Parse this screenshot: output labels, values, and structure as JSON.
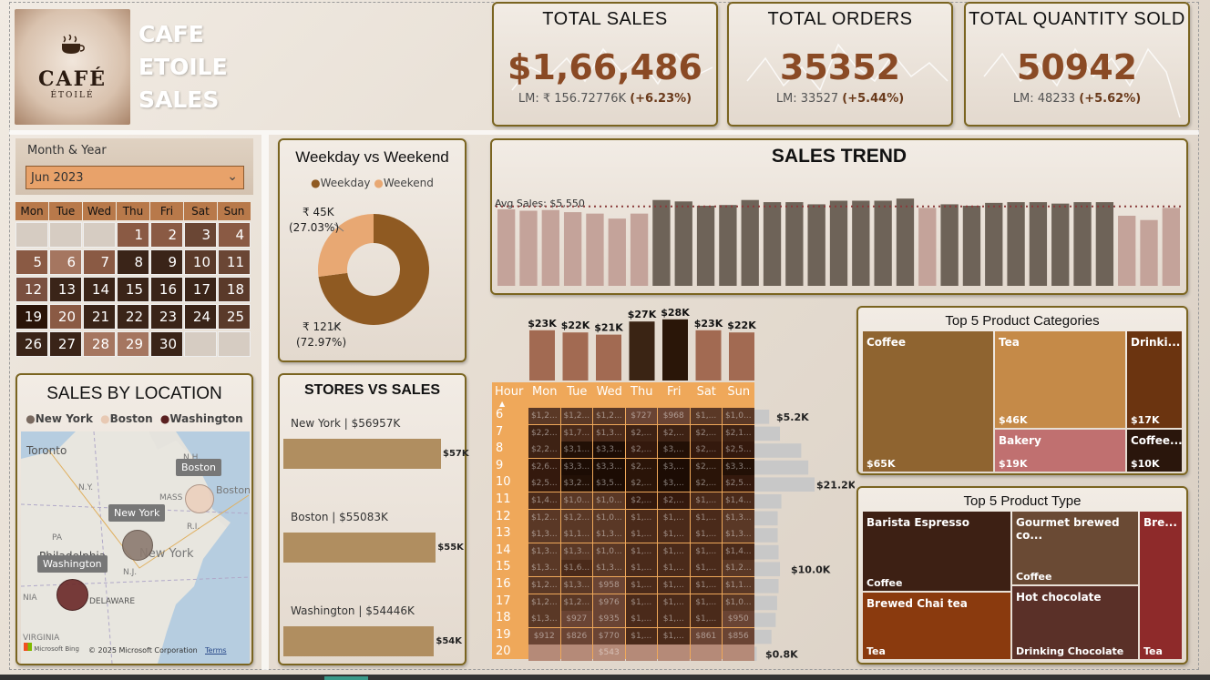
{
  "header": {
    "title_line1": "CAFE",
    "title_line2": "ETOILE",
    "title_line3": "SALES",
    "logo_top": "CAFE",
    "logo_main": "CAFÉ",
    "logo_sub": "ÉTOILÉ"
  },
  "kpis": [
    {
      "title": "TOTAL SALES",
      "value": "$1,66,486",
      "sub_prefix": "LM: ₹ 156.72776K ",
      "sub_change": "(+6.23%)"
    },
    {
      "title": "TOTAL ORDERS",
      "value": "35352",
      "sub_prefix": "LM: 33527 ",
      "sub_change": "(+5.44%)"
    },
    {
      "title": "TOTAL QUANTITY SOLD",
      "value": "50942",
      "sub_prefix": "LM: 48233 ",
      "sub_change": "(+5.62%)"
    }
  ],
  "slicer": {
    "label": "Month & Year",
    "value": "Jun 2023"
  },
  "calendar": {
    "days": [
      "Mon",
      "Tue",
      "Wed",
      "Thu",
      "Fri",
      "Sat",
      "Sun"
    ],
    "weeks": [
      [
        "",
        "",
        "",
        "1",
        "2",
        "3",
        "4"
      ],
      [
        "5",
        "6",
        "7",
        "8",
        "9",
        "10",
        "11"
      ],
      [
        "12",
        "13",
        "14",
        "15",
        "16",
        "17",
        "18"
      ],
      [
        "19",
        "20",
        "21",
        "22",
        "23",
        "24",
        "25"
      ],
      [
        "26",
        "27",
        "28",
        "29",
        "30",
        "",
        ""
      ]
    ]
  },
  "weekday_weekend": {
    "title": "Weekday vs Weekend",
    "legend": [
      "Weekday",
      "Weekend"
    ],
    "colors": [
      "#8f5a22",
      "#e8a873"
    ],
    "chart_data": {
      "type": "pie",
      "labels": [
        "Weekday",
        "Weekend"
      ],
      "values": [
        121,
        45
      ],
      "value_labels": [
        "₹ 121K",
        "₹ 45K"
      ],
      "percent_labels": [
        "(72.97%)",
        "(27.03%)"
      ]
    }
  },
  "location": {
    "title": "SALES BY LOCATION",
    "legend": [
      "New York",
      "Boston",
      "Washington"
    ],
    "legend_colors": [
      "#7a6a60",
      "#e8c9b3",
      "#5a2020"
    ],
    "map_labels": {
      "toronto": "Toronto",
      "ny_state": "N.Y.",
      "pa": "PA",
      "philadelphia": "Philadelphia",
      "new_york_city": "New York",
      "nj": "N.J.",
      "delaware": "DELAWARE",
      "nia": "NIA",
      "virginia": "VIRGINIA",
      "mass": "MASS",
      "ri": "R.I.",
      "nh": "N.H.",
      "boston_city": "Boston"
    },
    "bubbles": [
      "Boston",
      "New York",
      "Washington"
    ],
    "copyright": "© 2025 Microsoft Corporation",
    "terms": "Terms",
    "bing": "Microsoft Bing"
  },
  "stores": {
    "title": "STORES VS SALES",
    "chart_data": {
      "type": "bar",
      "categories": [
        "New York",
        "Boston",
        "Washington"
      ],
      "values": [
        56957,
        55083,
        54446
      ],
      "category_labels": [
        "New York | $56957K",
        "Boston | $55083K",
        "Washington | $54446K"
      ],
      "value_labels": [
        "$57K",
        "$55K",
        "$54K"
      ]
    }
  },
  "trend": {
    "title": "SALES TREND",
    "avg_label": "Avg Sales: $5,550",
    "chart_data": {
      "type": "bar",
      "avg": 5550,
      "ylim": [
        0,
        7000
      ],
      "values": [
        5350,
        5250,
        5300,
        5150,
        5050,
        4700,
        5050,
        6000,
        5900,
        5600,
        5650,
        6000,
        5850,
        5850,
        5700,
        5950,
        5950,
        5950,
        6100,
        5450,
        5700,
        5600,
        5800,
        5850,
        5850,
        5750,
        5850,
        5850,
        4900,
        4600,
        5450
      ]
    }
  },
  "dow_bars": {
    "chart_data": {
      "type": "bar",
      "categories": [
        "Mon",
        "Tue",
        "Wed",
        "Thu",
        "Fri",
        "Sat",
        "Sun"
      ],
      "values": [
        23,
        22,
        21,
        27,
        28,
        23,
        22
      ],
      "value_labels": [
        "$23K",
        "$22K",
        "$21K",
        "$27K",
        "$28K",
        "$23K",
        "$22K"
      ],
      "colors": [
        "#a26a52",
        "#a26a52",
        "#a26a52",
        "#3a2414",
        "#2a1608",
        "#a26a52",
        "#a26a52"
      ]
    }
  },
  "heatmap": {
    "hour_label": "Hour",
    "days": [
      "Mon",
      "Tue",
      "Wed",
      "Thu",
      "Fri",
      "Sat",
      "Sun"
    ],
    "hours": [
      "6",
      "7",
      "8",
      "9",
      "10",
      "11",
      "12",
      "13",
      "14",
      "15",
      "16",
      "17",
      "18",
      "19",
      "20"
    ],
    "cells": [
      [
        "$1,2...",
        "$1,2...",
        "$1,2...",
        "$727",
        "$968",
        "$1,...",
        "$1,0..."
      ],
      [
        "$2,2...",
        "$1,7...",
        "$1,3...",
        "$2,...",
        "$2,...",
        "$2,...",
        "$2,1..."
      ],
      [
        "$2,2...",
        "$3,1...",
        "$3,3...",
        "$2,...",
        "$3,...",
        "$2,...",
        "$2,5..."
      ],
      [
        "$2,6...",
        "$3,3...",
        "$3,3...",
        "$2,...",
        "$3,...",
        "$2,...",
        "$3,3..."
      ],
      [
        "$2,5...",
        "$3,2...",
        "$3,5...",
        "$2,...",
        "$3,...",
        "$2,...",
        "$2,5..."
      ],
      [
        "$1,4...",
        "$1,0...",
        "$1,0...",
        "$2,...",
        "$2,...",
        "$1,...",
        "$1,4..."
      ],
      [
        "$1,2...",
        "$1,2...",
        "$1,0...",
        "$1,...",
        "$1,...",
        "$1,...",
        "$1,3..."
      ],
      [
        "$1,3...",
        "$1,1...",
        "$1,3...",
        "$1,...",
        "$1,...",
        "$1,...",
        "$1,3..."
      ],
      [
        "$1,3...",
        "$1,3...",
        "$1,0...",
        "$1,...",
        "$1,...",
        "$1,...",
        "$1,4..."
      ],
      [
        "$1,3...",
        "$1,6...",
        "$1,3...",
        "$1,...",
        "$1,...",
        "$1,...",
        "$1,2..."
      ],
      [
        "$1,2...",
        "$1,3...",
        "$958",
        "$1,...",
        "$1,...",
        "$1,...",
        "$1,1..."
      ],
      [
        "$1,2...",
        "$1,2...",
        "$976",
        "$1,...",
        "$1,...",
        "$1,...",
        "$1,0..."
      ],
      [
        "$1,3...",
        "$927",
        "$935",
        "$1,...",
        "$1,...",
        "$1,...",
        "$950"
      ],
      [
        "$912",
        "$826",
        "$770",
        "$1,...",
        "$1,...",
        "$861",
        "$856"
      ],
      [
        "",
        "",
        "$543",
        "",
        "",
        "",
        ""
      ]
    ],
    "intensity": [
      [
        2,
        2,
        2,
        1,
        1,
        2,
        2
      ],
      [
        4,
        3,
        3,
        4,
        4,
        4,
        4
      ],
      [
        4,
        7,
        8,
        5,
        7,
        5,
        5
      ],
      [
        5,
        8,
        8,
        6,
        8,
        6,
        7
      ],
      [
        5,
        7,
        8,
        6,
        8,
        6,
        5
      ],
      [
        3,
        2,
        2,
        5,
        5,
        3,
        3
      ],
      [
        2,
        2,
        2,
        3,
        3,
        3,
        2
      ],
      [
        2,
        2,
        2,
        3,
        3,
        3,
        2
      ],
      [
        2,
        2,
        2,
        3,
        3,
        3,
        3
      ],
      [
        2,
        3,
        2,
        3,
        3,
        3,
        2
      ],
      [
        2,
        2,
        1,
        3,
        3,
        3,
        2
      ],
      [
        2,
        2,
        1,
        3,
        3,
        3,
        2
      ],
      [
        2,
        1,
        1,
        3,
        3,
        3,
        1
      ],
      [
        1,
        1,
        1,
        3,
        3,
        1,
        1
      ],
      [
        0,
        0,
        0,
        0,
        0,
        0,
        0
      ]
    ]
  },
  "hour_bars": {
    "chart_data": {
      "type": "bar",
      "values": [
        5.2,
        9.0,
        16.5,
        19.0,
        21.2,
        9.5,
        8.2,
        8.2,
        8.5,
        9.0,
        8.5,
        8.0,
        7.5,
        6.0,
        0.8
      ],
      "value_labels": [
        "$5.2K",
        "$21.2K",
        "$10.0K",
        "$0.8K"
      ]
    }
  },
  "categories": {
    "title": "Top 5 Product Categories",
    "items": [
      {
        "name": "Coffee",
        "value": "$65K",
        "color": "#8f6430"
      },
      {
        "name": "Tea",
        "value": "$46K",
        "color": "#c58a48"
      },
      {
        "name": "Drinki...",
        "value": "$17K",
        "color": "#6b3410"
      },
      {
        "name": "Bakery",
        "value": "$19K",
        "color": "#c07070"
      },
      {
        "name": "Coffee...",
        "value": "$10K",
        "color": "#2a160c"
      }
    ]
  },
  "product_types": {
    "title": "Top 5 Product Type",
    "items": [
      {
        "name": "Barista Espresso",
        "group": "Coffee",
        "color": "#3d2014"
      },
      {
        "name": "Gourmet brewed co...",
        "group": "Coffee",
        "color": "#6a4a34"
      },
      {
        "name": "Bre...",
        "group": "Tea",
        "color": "#8e2a2a"
      },
      {
        "name": "Brewed Chai tea",
        "group": "Tea",
        "color": "#8a3a0e"
      },
      {
        "name": "Hot chocolate",
        "group": "Drinking Chocolate",
        "color": "#5a3028"
      }
    ]
  }
}
